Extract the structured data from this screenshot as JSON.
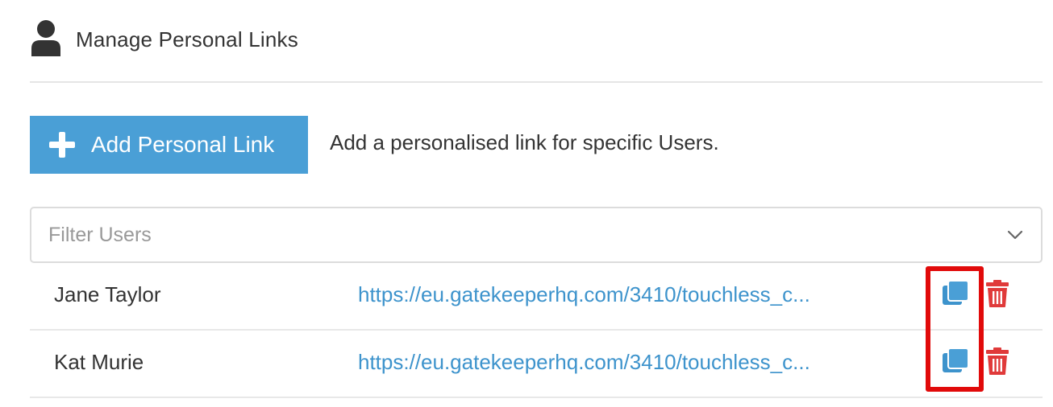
{
  "header": {
    "title": "Manage Personal Links",
    "icon": "user-icon"
  },
  "add_button": {
    "label": "Add Personal Link",
    "icon": "plus-icon",
    "description": "Add a personalised link for specific Users."
  },
  "filter": {
    "placeholder": "Filter Users",
    "value": ""
  },
  "links": [
    {
      "name": "Jane Taylor",
      "url": "https://eu.gatekeeperhq.com/3410/touchless_c..."
    },
    {
      "name": "Kat Murie",
      "url": "https://eu.gatekeeperhq.com/3410/touchless_c..."
    }
  ],
  "colors": {
    "accent": "#4a9fd6",
    "link": "#3d93cc",
    "delete": "#e03a3a",
    "highlight": "#e10a0a"
  }
}
